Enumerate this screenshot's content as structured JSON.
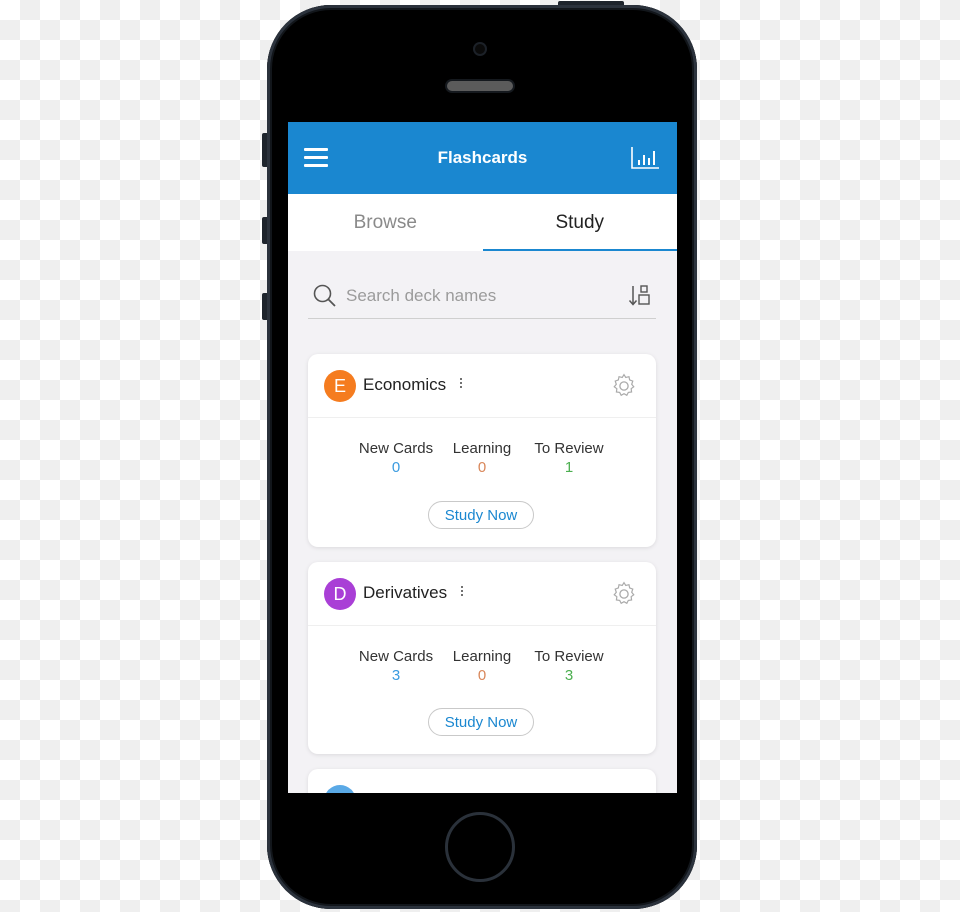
{
  "app": {
    "title": "Flashcards",
    "header_color": "#1a87d0"
  },
  "header": {
    "menu_icon": "hamburger-menu-icon",
    "stats_icon": "bar-chart-icon"
  },
  "tabs": [
    {
      "label": "Browse",
      "active": false
    },
    {
      "label": "Study",
      "active": true
    }
  ],
  "search": {
    "placeholder": "Search deck names",
    "value": "",
    "sort_icon": "sort-icon"
  },
  "stat_colors": {
    "new_cards": "#3a9be0",
    "learning": "#d9875a",
    "to_review": "#4caf50"
  },
  "decks": [
    {
      "initial": "E",
      "name": "Economics",
      "avatar_color": "#f57c1f",
      "stats": [
        {
          "label": "New Cards",
          "value": "0"
        },
        {
          "label": "Learning",
          "value": "0"
        },
        {
          "label": "To Review",
          "value": "1"
        }
      ],
      "button_label": "Study Now"
    },
    {
      "initial": "D",
      "name": "Derivatives",
      "avatar_color": "#a93fd6",
      "stats": [
        {
          "label": "New Cards",
          "value": "3"
        },
        {
          "label": "Learning",
          "value": "0"
        },
        {
          "label": "To Review",
          "value": "3"
        }
      ],
      "button_label": "Study Now"
    },
    {
      "initial": "",
      "name": "",
      "avatar_color": "#5aa9e6"
    }
  ]
}
